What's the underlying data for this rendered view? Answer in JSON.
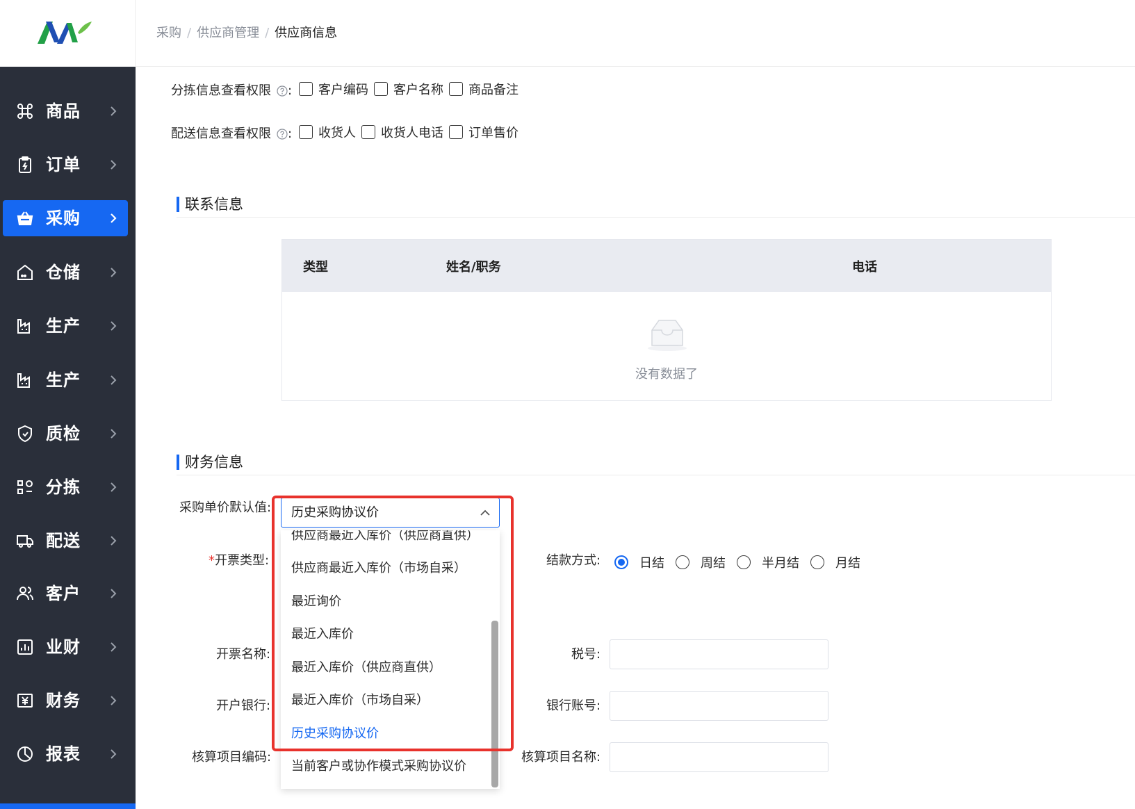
{
  "brand": {
    "colors": {
      "primary": "#1668f2",
      "sidebar_bg": "#2a2f3a",
      "highlight": "#e8322c"
    }
  },
  "sidebar": {
    "items": [
      {
        "label": "商品",
        "icon": "command-icon"
      },
      {
        "label": "订单",
        "icon": "clipboard-icon"
      },
      {
        "label": "采购",
        "icon": "basket-icon",
        "active": true
      },
      {
        "label": "仓储",
        "icon": "warehouse-icon"
      },
      {
        "label": "生产",
        "icon": "factory-icon"
      },
      {
        "label": "生产",
        "icon": "factory-icon"
      },
      {
        "label": "质检",
        "icon": "shield-check-icon"
      },
      {
        "label": "分拣",
        "icon": "sort-icon"
      },
      {
        "label": "配送",
        "icon": "truck-icon"
      },
      {
        "label": "客户",
        "icon": "users-icon"
      },
      {
        "label": "业财",
        "icon": "bar-chart-icon"
      },
      {
        "label": "财务",
        "icon": "yen-icon"
      },
      {
        "label": "报表",
        "icon": "pie-chart-icon"
      }
    ]
  },
  "breadcrumb": {
    "items": [
      "采购",
      "供应商管理",
      "供应商信息"
    ],
    "separator": "/"
  },
  "permissions": {
    "sorting": {
      "label": "分拣信息查看权限",
      "colon": ":",
      "options": [
        "客户编码",
        "客户名称",
        "商品备注"
      ]
    },
    "delivery": {
      "label": "配送信息查看权限",
      "colon": ":",
      "options": [
        "收货人",
        "收货人电话",
        "订单售价"
      ]
    }
  },
  "contact": {
    "title": "联系信息",
    "columns": [
      "类型",
      "姓名/职务",
      "电话"
    ],
    "empty_text": "没有数据了"
  },
  "finance": {
    "title": "财务信息",
    "price_default": {
      "label": "采购单价默认值:",
      "value": "历史采购协议价",
      "options": [
        "供应商最近入库价（供应商直供）",
        "供应商最近入库价（市场自采）",
        "最近询价",
        "最近入库价",
        "最近入库价（供应商直供）",
        "最近入库价（市场自采）",
        "历史采购协议价",
        "当前客户或协作模式采购协议价"
      ],
      "selected": "历史采购协议价"
    },
    "invoice_type_label": "开票类型:",
    "invoice_required_mark": "*",
    "settlement": {
      "label": "结款方式:",
      "options": [
        "日结",
        "周结",
        "半月结",
        "月结"
      ],
      "selected": "日结"
    },
    "invoice_name_label": "开票名称:",
    "tax_no_label": "税号:",
    "bank_label": "开户银行:",
    "bank_account_label": "银行账号:",
    "accounting_code_label": "核算项目编码:",
    "accounting_name_label": "核算项目名称:"
  }
}
